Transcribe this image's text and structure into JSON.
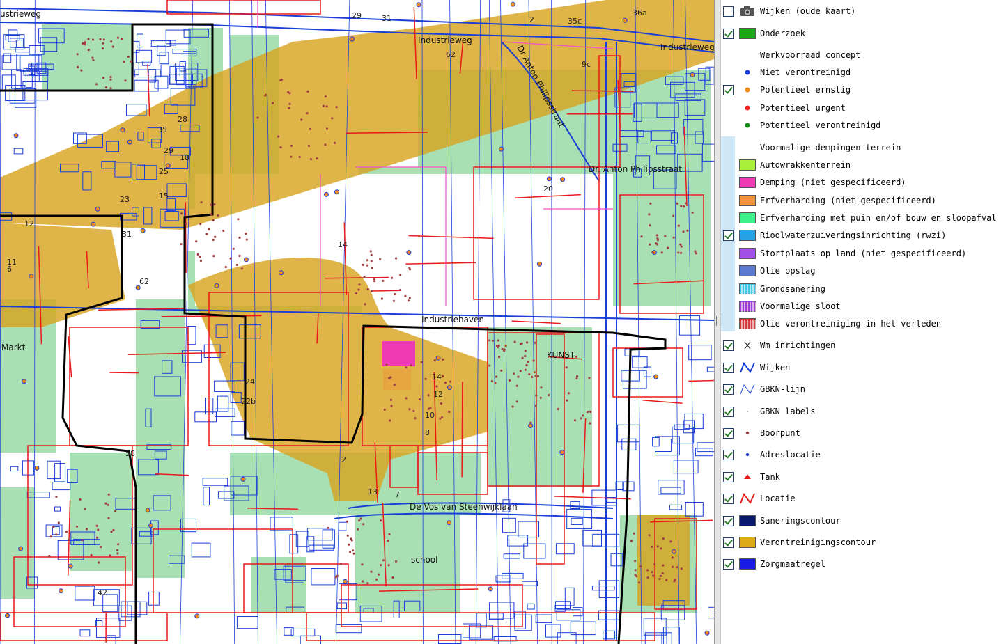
{
  "map": {
    "street_labels": [
      {
        "key": "industrieweg",
        "text": "Industrieweg"
      },
      {
        "key": "industrieweg_right",
        "text": "Industrieweg"
      },
      {
        "key": "philipsstraat_diag",
        "text": "Dr Anton Philipsstraat"
      },
      {
        "key": "philipsstraat",
        "text": "Dr. Anton Philipsstraat"
      },
      {
        "key": "industriehaven",
        "text": "Industriehaven"
      },
      {
        "key": "de_vos",
        "text": "De Vos van Steenwijklaan"
      },
      {
        "key": "school",
        "text": "school"
      },
      {
        "key": "kunst",
        "text": "KUNST"
      },
      {
        "key": "markt",
        "text": "Markt"
      },
      {
        "key": "ustrieweg",
        "text": "ustrieweg"
      }
    ],
    "number_labels": [
      "29",
      "31",
      "62",
      "35c",
      "36a",
      "2",
      "9c",
      "20",
      "14",
      "42",
      "12",
      "11",
      "35",
      "28",
      "29",
      "25",
      "18",
      "15",
      "23",
      "31",
      "14",
      "12",
      "10",
      "8",
      "2",
      "24",
      "22b",
      "13",
      "7",
      "6",
      "58",
      "62",
      "53"
    ]
  },
  "legend": {
    "items": [
      {
        "id": "wijken-oude-kaart",
        "label": "Wijken (oude kaart)",
        "checked": false,
        "symbol": "camera"
      },
      {
        "id": "onderzoek",
        "label": "Onderzoek",
        "checked": true,
        "symbol": "swatch",
        "color": "#1aa81a"
      },
      {
        "id": "werkvoorraad-concept",
        "label": "Werkvoorraad concept",
        "checked": null,
        "symbol": "none"
      },
      {
        "id": "niet-verontreinigd",
        "label": "Niet verontreinigd",
        "checked": null,
        "symbol": "dot",
        "color": "#1a3fd6"
      },
      {
        "id": "potentieel-ernstig",
        "label": "Potentieel ernstig",
        "checked": true,
        "symbol": "dot",
        "color": "#f08a1e"
      },
      {
        "id": "potentieel-urgent",
        "label": "Potentieel urgent",
        "checked": null,
        "symbol": "dot",
        "color": "#e81a1a"
      },
      {
        "id": "potentieel-verontreinigd",
        "label": "Potentieel verontreinigd",
        "checked": null,
        "symbol": "dot",
        "color": "#1a8a1a"
      },
      {
        "id": "voormalige-dempingen",
        "label": "Voormalige dempingen terrein",
        "checked": null,
        "symbol": "none"
      },
      {
        "id": "autowrakkenterrein",
        "label": "Autowrakkenterrein",
        "checked": null,
        "symbol": "swatch",
        "color": "#a8f03c"
      },
      {
        "id": "demping",
        "label": "Demping (niet gespecificeerd)",
        "checked": null,
        "symbol": "swatch",
        "color": "#f03cb4"
      },
      {
        "id": "erfverharding",
        "label": "Erfverharding (niet gespecificeerd)",
        "checked": null,
        "symbol": "swatch",
        "color": "#f0963c"
      },
      {
        "id": "erfverharding-puin",
        "label": "Erfverharding met puin en/of bouw en sloopafval",
        "checked": null,
        "symbol": "swatch",
        "color": "#3cf08c"
      },
      {
        "id": "rwzi",
        "label": "Rioolwaterzuiveringsinrichting (rwzi)",
        "checked": true,
        "symbol": "swatch",
        "color": "#28a0e6"
      },
      {
        "id": "stortplaats",
        "label": "Stortplaats op land (niet gespecificeerd)",
        "checked": null,
        "symbol": "swatch",
        "color": "#a050e6"
      },
      {
        "id": "olie-opslag",
        "label": "Olie opslag",
        "checked": null,
        "symbol": "swatch",
        "color": "#5a7ad2"
      },
      {
        "id": "grondsanering",
        "label": "Grondsanering",
        "checked": null,
        "symbol": "hatch",
        "color": "#3cc8e6"
      },
      {
        "id": "voormalige-sloot",
        "label": "Voormalige sloot",
        "checked": null,
        "symbol": "hatch",
        "color": "#a03cd2"
      },
      {
        "id": "olie-verleden",
        "label": "Olie verontreiniging in het verleden",
        "checked": null,
        "symbol": "hatch",
        "color": "#d23c3c"
      },
      {
        "id": "wm-inrichtingen",
        "label": "Wm inrichtingen",
        "checked": true,
        "symbol": "cross",
        "color": "#333333"
      },
      {
        "id": "wijken",
        "label": "Wijken",
        "checked": true,
        "symbol": "zigzag",
        "color": "#1a3fd6"
      },
      {
        "id": "gbkn-lijn",
        "label": "GBKN-lijn",
        "checked": true,
        "symbol": "zigzag-thin",
        "color": "#1a3fd6"
      },
      {
        "id": "gbkn-labels",
        "label": "GBKN labels",
        "checked": true,
        "symbol": "smalldot",
        "color": "#888888"
      },
      {
        "id": "boorpunt",
        "label": "Boorpunt",
        "checked": true,
        "symbol": "dot-small",
        "color": "#a04040"
      },
      {
        "id": "adreslocatie",
        "label": "Adreslocatie",
        "checked": true,
        "symbol": "dot-small",
        "color": "#1a3fd6"
      },
      {
        "id": "tank",
        "label": "Tank",
        "checked": true,
        "symbol": "triangle",
        "color": "#e81a1a"
      },
      {
        "id": "locatie",
        "label": "Locatie",
        "checked": true,
        "symbol": "zigzag",
        "color": "#e81a1a"
      },
      {
        "id": "saneringscontour",
        "label": "Saneringscontour",
        "checked": true,
        "symbol": "swatch",
        "color": "#0a1a6e"
      },
      {
        "id": "verontreinigingscontour",
        "label": "Verontreinigingscontour",
        "checked": true,
        "symbol": "swatch",
        "color": "#dcaa14"
      },
      {
        "id": "zorgmaatregel",
        "label": "Zorgmaatregel",
        "checked": true,
        "symbol": "swatch",
        "color": "#1a1ae6"
      }
    ]
  },
  "colors": {
    "parcel_green": "#a8e0b4",
    "contamination": "#d8a420",
    "gbkn_blue": "#1a3fd6",
    "location_red": "#e81a1a",
    "wijk_black": "#000000",
    "demping_pink": "#f03cb4",
    "road_magenta": "#f050c8"
  }
}
